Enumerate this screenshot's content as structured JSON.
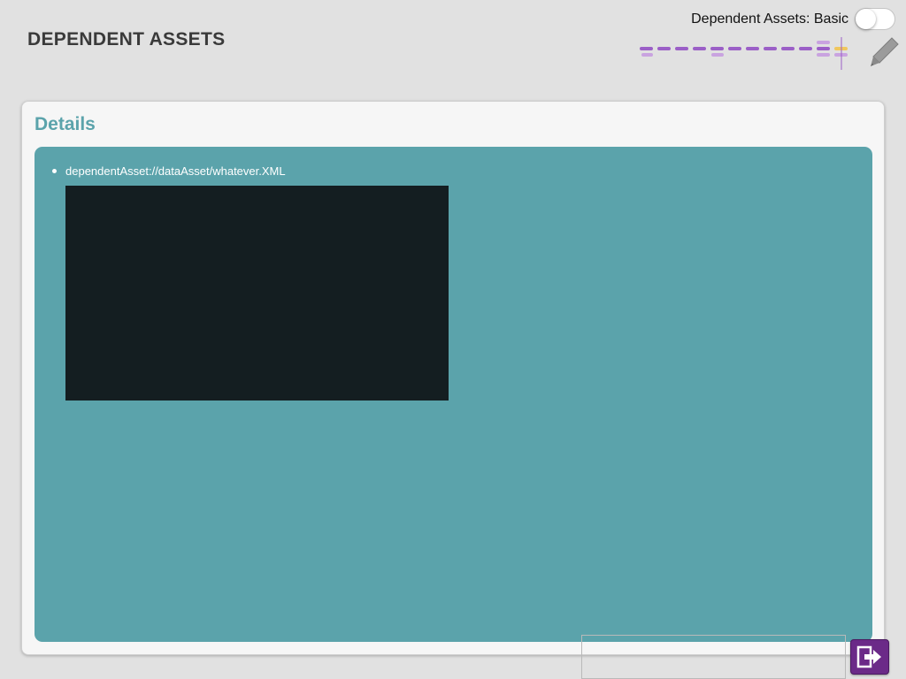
{
  "header": {
    "title": "DEPENDENT ASSETS",
    "mode_label": "Dependent Assets: Basic",
    "mode_toggle_on": false
  },
  "card": {
    "heading": "Details",
    "assets": [
      {
        "path": "dependentAsset://dataAsset/whatever.XML"
      }
    ]
  },
  "colors": {
    "accent": "#5ba3ab",
    "preview_bg": "#141e21",
    "timeline_purple": "#9b5fc7",
    "timeline_light": "#c9a3e0",
    "timeline_marker": "#f0c75e",
    "exit_button": "#6b2a88"
  },
  "icons": {
    "toolbar": "pencil-icon",
    "exit": "exit-icon"
  }
}
